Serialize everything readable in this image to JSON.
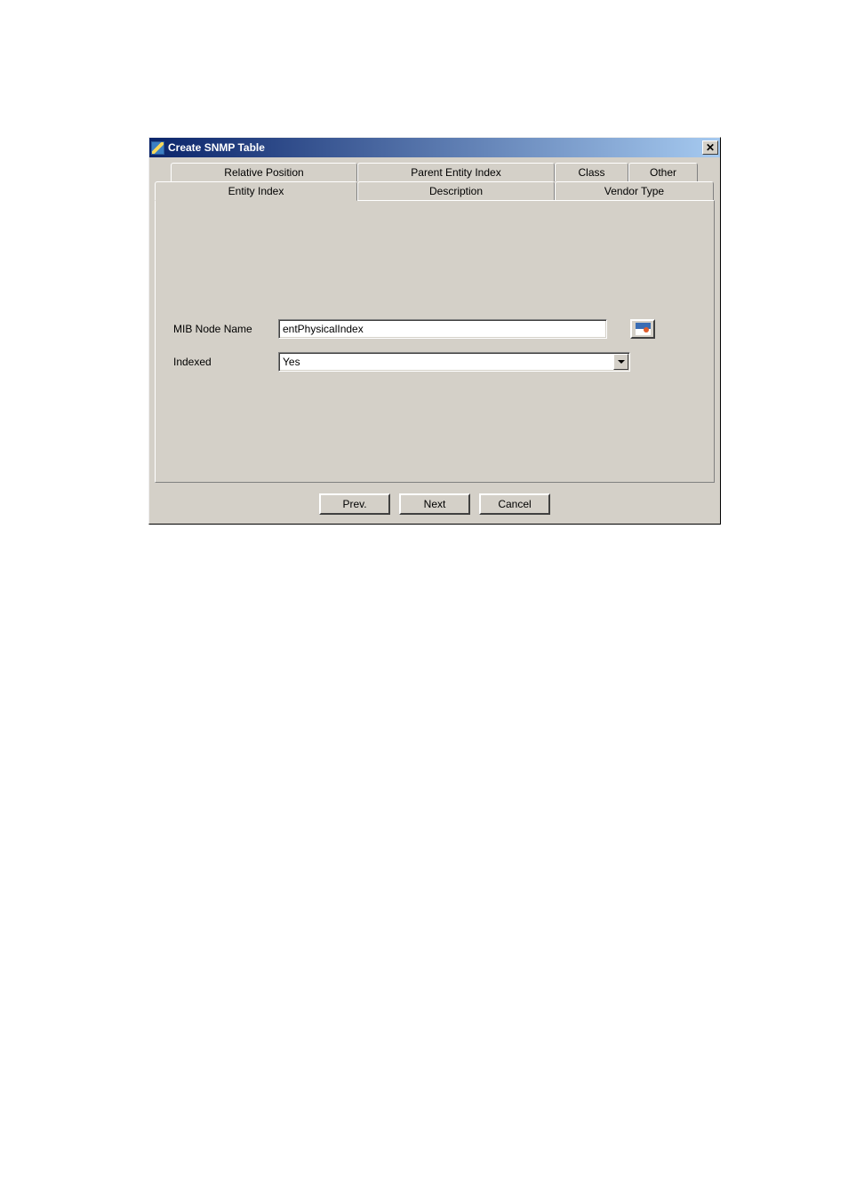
{
  "window": {
    "title": "Create SNMP Table"
  },
  "tabs": {
    "top": [
      "Relative Position",
      "Parent Entity Index",
      "Class",
      "Other"
    ],
    "bottom": [
      "Entity Index",
      "Description",
      "Vendor Type"
    ]
  },
  "form": {
    "mib_node_name": {
      "label": "MIB Node Name",
      "value": "entPhysicalIndex"
    },
    "indexed": {
      "label": "Indexed",
      "value": "Yes"
    }
  },
  "buttons": {
    "prev": "Prev.",
    "next": "Next",
    "cancel": "Cancel"
  }
}
